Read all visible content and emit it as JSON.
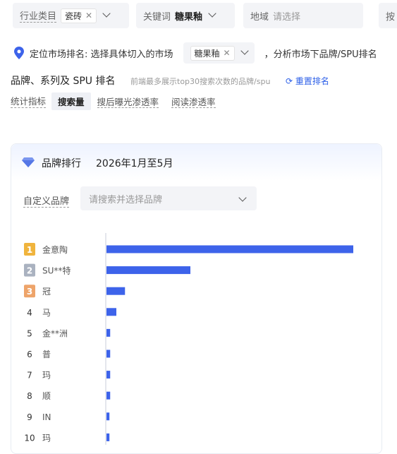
{
  "filters": {
    "industry": {
      "label": "行业类目",
      "tag": "瓷砖"
    },
    "keyword": {
      "label": "关键词",
      "value": "糖果釉"
    },
    "region": {
      "label": "地域",
      "placeholder": "请选择"
    },
    "cut_label": "按"
  },
  "position": {
    "label": "定位市场排名: 选择具体切入的市场",
    "tag": "糖果釉",
    "suffix": "，分析市场下品牌/SPU排名"
  },
  "section": {
    "title": "品牌、系列及 SPU 排名",
    "note": "前端最多展示top30搜索次数的品牌/spu",
    "reset": "重置排名"
  },
  "metrics": {
    "label": "统计指标",
    "items": [
      "搜索量",
      "搜后曝光渗透率",
      "阅读渗透率"
    ],
    "active": "搜索量"
  },
  "card": {
    "title": "品牌排行",
    "date": "2026年1月至5月",
    "brand_filter_label": "自定义品牌",
    "brand_filter_placeholder": "请搜索并选择品牌"
  },
  "colors": {
    "accent": "#2c5fe8",
    "bar": "#3d63ea",
    "gold": "#f0b43d",
    "silver": "#aab2c0",
    "bronze": "#eea46a"
  },
  "chart_data": {
    "type": "bar",
    "orientation": "horizontal",
    "categories": [
      "金意陶",
      "SU**特",
      "冠",
      "马",
      "金**洲",
      "普",
      "玛",
      "顺",
      "IN",
      "玛"
    ],
    "ranks": [
      "1",
      "2",
      "3",
      "4",
      "5",
      "6",
      "7",
      "8",
      "9",
      "10"
    ],
    "values": [
      100,
      34,
      7.5,
      4,
      1.5,
      1.5,
      1.5,
      1.5,
      1.2,
      1.2
    ],
    "xlim": [
      0,
      100
    ]
  }
}
